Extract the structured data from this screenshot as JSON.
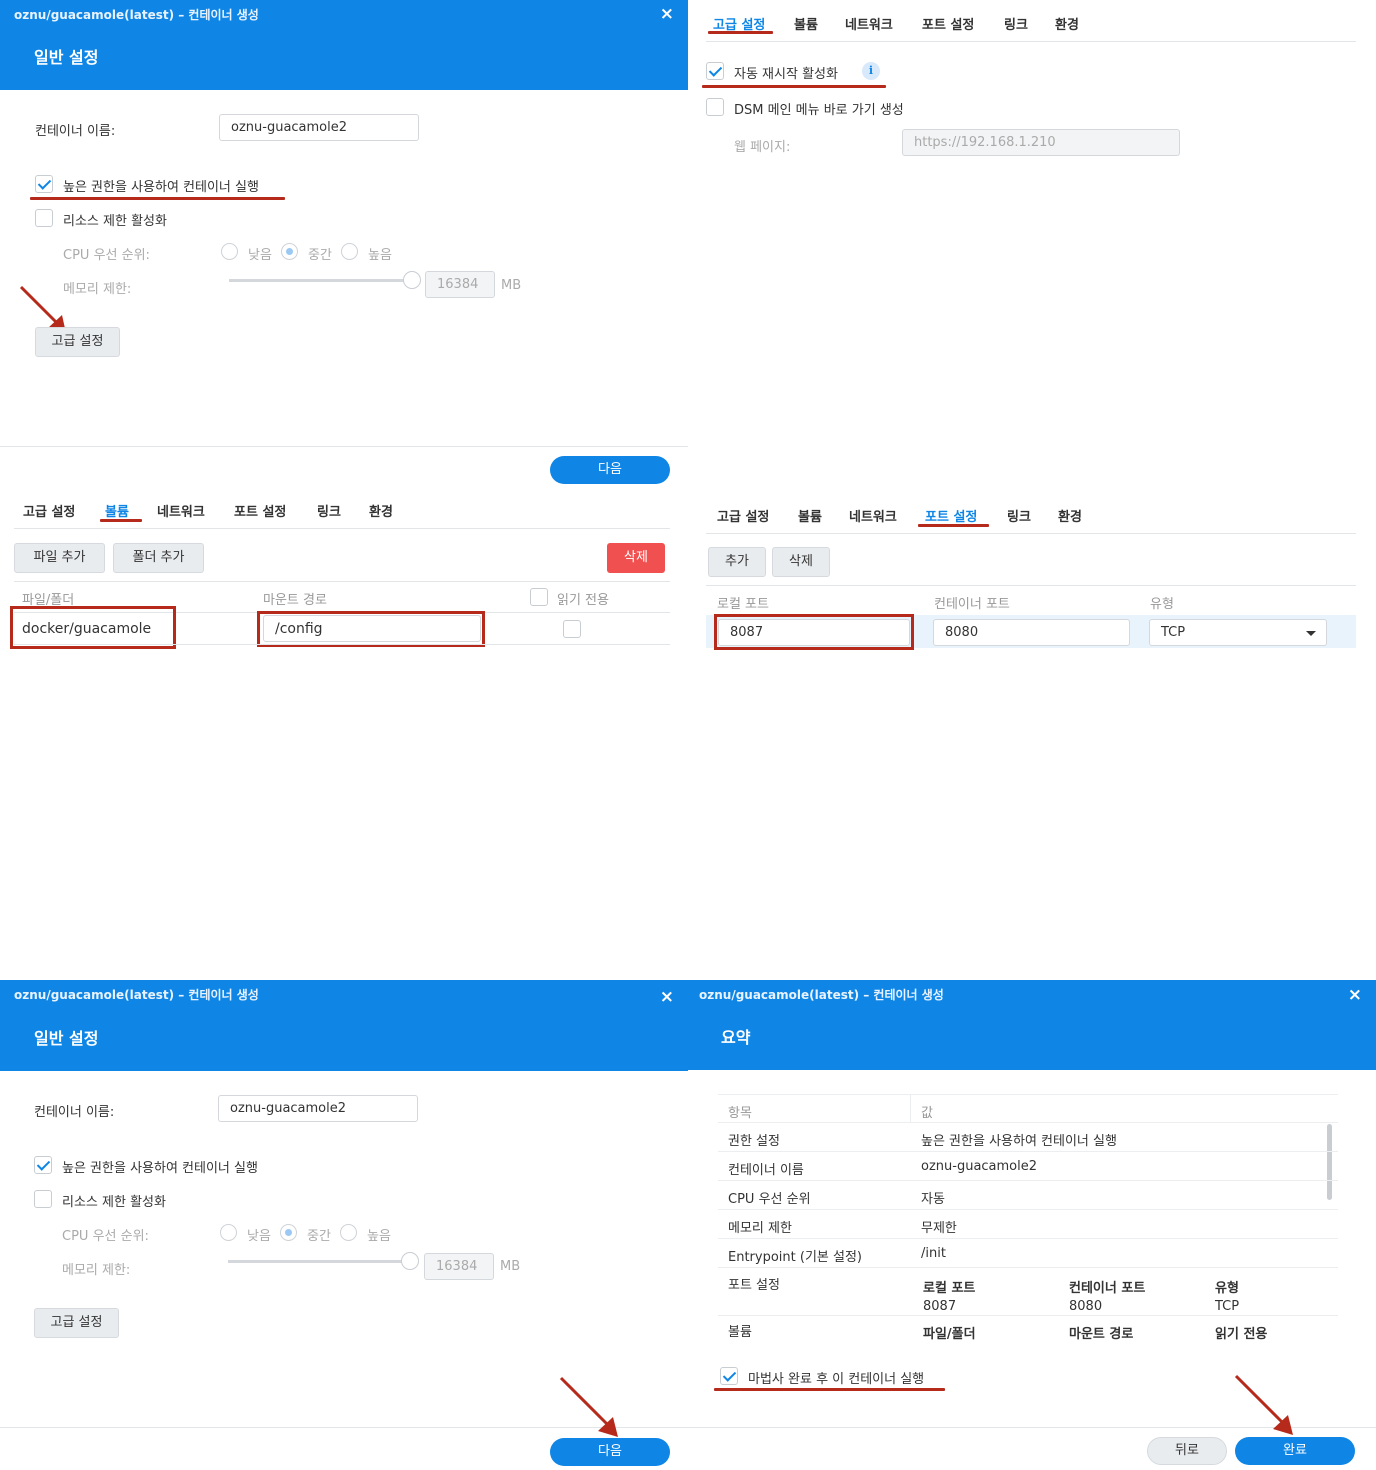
{
  "window_title": "oznu/guacamole(latest) – 컨테이너 생성",
  "close_glyph": "×",
  "general": {
    "section_title": "일반 설정",
    "container_name_label": "컨테이너 이름:",
    "container_name_value": "oznu-guacamole2",
    "privileged_label": "높은 권한을 사용하여 컨테이너 실행",
    "resource_limit_label": "리소스 제한 활성화",
    "cpu_priority_label": "CPU 우선 순위:",
    "cpu_low": "낮음",
    "cpu_mid": "중간",
    "cpu_high": "높음",
    "memory_limit_label": "메모리 제한:",
    "memory_value": "16384",
    "memory_unit": "MB",
    "advanced_button": "고급 설정",
    "next_button": "다음"
  },
  "tabs": {
    "advanced": "고급 설정",
    "volume": "볼륨",
    "network": "네트워크",
    "port": "포트 설정",
    "link": "링크",
    "env": "환경"
  },
  "advanced": {
    "auto_restart_label": "자동 재시작 활성화",
    "info_glyph": "i",
    "dsm_shortcut_label": "DSM 메인 메뉴 바로 가기 생성",
    "webpage_label": "웹 페이지:",
    "webpage_value": "https://192.168.1.210"
  },
  "volume": {
    "add_file": "파일 추가",
    "add_folder": "폴더 추가",
    "delete": "삭제",
    "col_file_folder": "파일/폴더",
    "col_mount_path": "마운트 경로",
    "col_readonly": "읽기 전용",
    "row_file": "docker/guacamole",
    "row_mount": "/config"
  },
  "port": {
    "add": "추가",
    "delete": "삭제",
    "col_local": "로컬 포트",
    "col_container": "컨테이너 포트",
    "col_type": "유형",
    "local_value": "8087",
    "container_value": "8080",
    "type_value": "TCP"
  },
  "summary": {
    "section_title": "요약",
    "col_item": "항목",
    "col_value": "값",
    "rows": [
      {
        "k": "권한 설정",
        "v": "높은 권한을 사용하여 컨테이너 실행"
      },
      {
        "k": "컨테이너 이름",
        "v": "oznu-guacamole2"
      },
      {
        "k": "CPU 우선 순위",
        "v": "자동"
      },
      {
        "k": "메모리 제한",
        "v": "무제한"
      },
      {
        "k": "Entrypoint (기본 설정)",
        "v": "/init"
      }
    ],
    "port_key": "포트 설정",
    "port_h_local": "로컬 포트",
    "port_h_container": "컨테이너 포트",
    "port_h_type": "유형",
    "port_v_local": "8087",
    "port_v_container": "8080",
    "port_v_type": "TCP",
    "volume_key": "볼륨",
    "vol_h_file": "파일/폴더",
    "vol_h_mount": "마운트 경로",
    "vol_h_readonly": "읽기 전용",
    "run_after_label": "마법사 완료 후 이 컨테이너 실행",
    "back_button": "뒤로",
    "finish_button": "완료"
  },
  "colors": {
    "accent": "#0f86e6",
    "annotation_red": "#b52a1b",
    "delete_red": "#f05050"
  }
}
